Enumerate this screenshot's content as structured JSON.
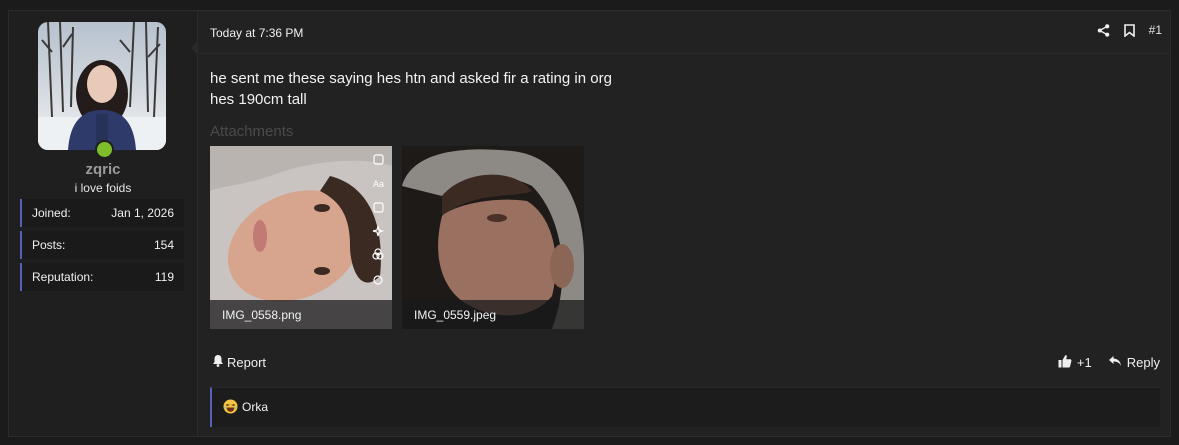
{
  "user": {
    "username": "zqric",
    "title": "i love foids",
    "stats": [
      {
        "label": "Joined:",
        "value": "Jan 1, 2026"
      },
      {
        "label": "Posts:",
        "value": "154"
      },
      {
        "label": "Reputation:",
        "value": "119"
      }
    ],
    "online": true
  },
  "post": {
    "timestamp": "Today at 7:36 PM",
    "number": "#1",
    "lines": [
      "he sent me these saying hes htn and asked fir a rating in org",
      "hes 190cm tall"
    ],
    "attachments_label": "Attachments",
    "attachments": [
      {
        "filename": "IMG_0558.png"
      },
      {
        "filename": "IMG_0559.jpeg"
      }
    ]
  },
  "actions": {
    "report_label": "Report",
    "like_count": "+1",
    "reply_label": "Reply"
  },
  "reactions": {
    "users": "Orka"
  },
  "colors": {
    "accent": "#5560b8",
    "online": "#7fbd2b"
  },
  "icons": [
    "share-icon",
    "bookmark-icon",
    "bell-icon",
    "thumbs-up-icon",
    "reply-icon",
    "laughing-emoji-icon"
  ]
}
